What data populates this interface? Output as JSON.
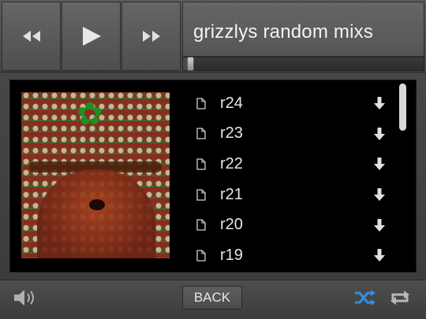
{
  "header": {
    "title": "grizzlys random mixs",
    "progress": 0.03
  },
  "controls": {
    "rewind": "rewind-icon",
    "play": "play-icon",
    "forward": "fast-forward-icon"
  },
  "playlist": {
    "items": [
      {
        "label": "r24"
      },
      {
        "label": "r23"
      },
      {
        "label": "r22"
      },
      {
        "label": "r21"
      },
      {
        "label": "r20"
      },
      {
        "label": "r19"
      }
    ]
  },
  "footer": {
    "back_label": "BACK",
    "shuffle_on": true,
    "repeat_on": false
  },
  "colors": {
    "accent": "#2f8fe0",
    "icon": "#bdbdbd",
    "text": "#e6e6e6"
  }
}
